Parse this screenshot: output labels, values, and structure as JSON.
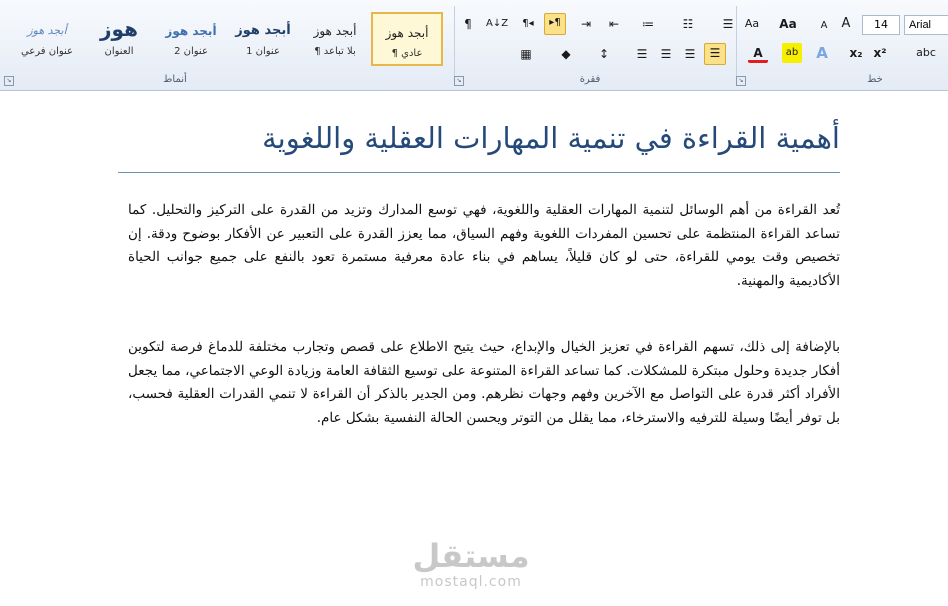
{
  "ribbon": {
    "groups": {
      "styles": "أنماط",
      "paragraph": "فقرة",
      "font": "خط"
    },
    "styles_gallery": [
      {
        "sample": "أبجد هوز",
        "name": "¶ عادي"
      },
      {
        "sample": "أبجد هوز",
        "name": "¶ بلا تباعد"
      },
      {
        "sample": "أبجد هوز",
        "name": "عنوان 1"
      },
      {
        "sample": "أبجد هوز",
        "name": "عنوان 2"
      },
      {
        "sample": "هوز",
        "name": "العنوان"
      },
      {
        "sample": "أبجد هوز",
        "name": "عنوان فرعي"
      }
    ],
    "font": {
      "name": "Arial",
      "size": "14"
    },
    "buttons": {
      "pilcrow": "¶",
      "sort": "A↓Z",
      "ltr": "¶◂",
      "rtl": "▸¶",
      "grow": "A",
      "shrink": "A",
      "change_case": "Aa",
      "clear_format": "Aa",
      "bold_sub": "x₂",
      "superscript": "x²",
      "strike": "abc",
      "font_color": "A",
      "highlight": "ab",
      "text_effect": "A"
    }
  },
  "document": {
    "title": "أهمية القراءة في تنمية المهارات العقلية واللغوية",
    "paragraphs": [
      "تُعد القراءة من أهم الوسائل لتنمية المهارات العقلية واللغوية، فهي توسع المدارك وتزيد من القدرة على التركيز والتحليل. كما تساعد القراءة المنتظمة على تحسين المفردات اللغوية وفهم السياق، مما يعزز القدرة على التعبير عن الأفكار بوضوح ودقة. إن تخصيص وقت يومي للقراءة، حتى لو كان قليلاً، يساهم في بناء عادة معرفية مستمرة تعود بالنفع على جميع جوانب الحياة الأكاديمية والمهنية.",
      "بالإضافة إلى ذلك، تسهم القراءة في تعزيز الخيال والإبداع، حيث يتيح الاطلاع على قصص وتجارب مختلفة للدماغ فرصة لتكوين أفكار جديدة وحلول مبتكرة للمشكلات. كما تساعد القراءة المتنوعة على توسيع الثقافة العامة وزيادة الوعي الاجتماعي، مما يجعل الأفراد أكثر قدرة على التواصل مع الآخرين وفهم وجهات نظرهم. ومن الجدير بالذكر أن القراءة لا تنمي القدرات العقلية فحسب، بل توفر أيضًا وسيلة للترفيه والاسترخاء، مما يقلل من التوتر ويحسن الحالة النفسية بشكل عام."
    ]
  },
  "watermark": {
    "arabic": "مستقل",
    "latin": "mostaql.com"
  },
  "colors": {
    "title": "#254a7a",
    "ribbon_bg": "#e4ebf5",
    "active_button": "#fbe28a"
  }
}
